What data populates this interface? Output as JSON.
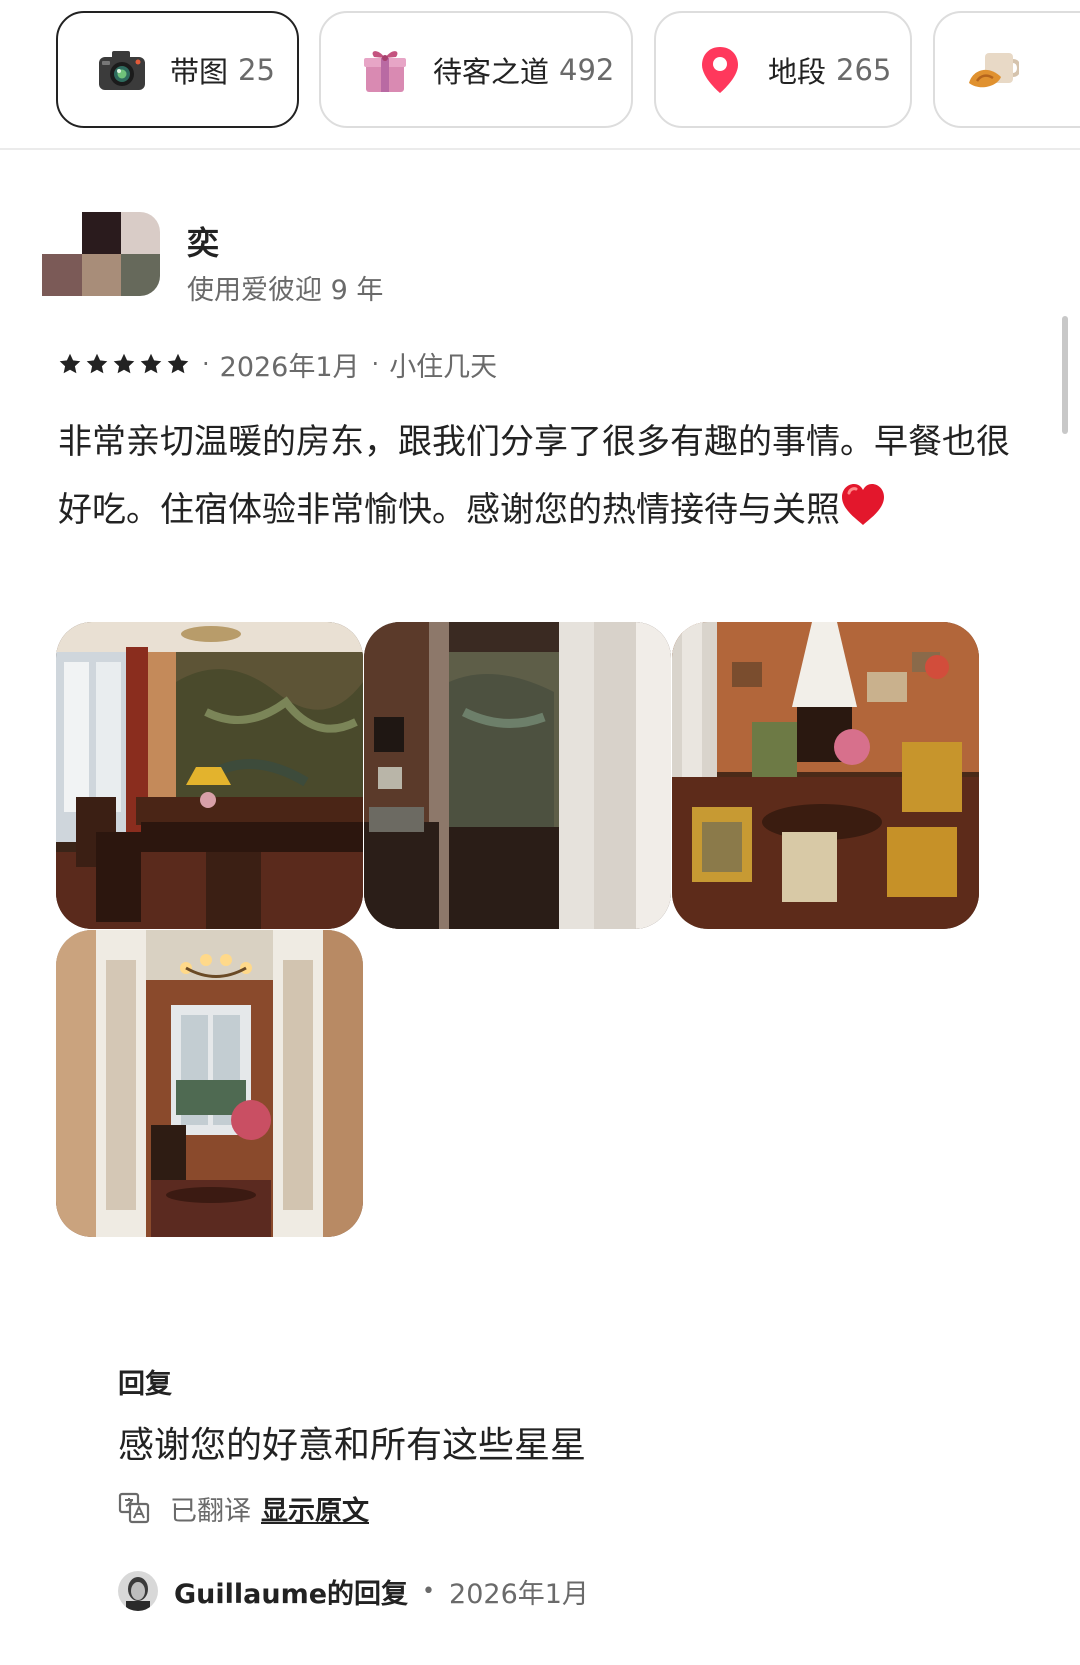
{
  "filters": [
    {
      "label": "带图",
      "count": "25",
      "icon": "camera-icon",
      "selected": true
    },
    {
      "label": "待客之道",
      "count": "492",
      "icon": "gift-icon",
      "selected": false
    },
    {
      "label": "地段",
      "count": "265",
      "icon": "location-pin-icon",
      "selected": false
    },
    {
      "label": "",
      "count": "",
      "icon": "breakfast-icon",
      "selected": false
    }
  ],
  "review": {
    "reviewer_name": "奕",
    "tenure": "使用爱彼迎 9 年",
    "rating": 5,
    "separator": "·",
    "date": "2026年1月",
    "stay_type": "小住几天",
    "text": "非常亲切温暖的房东，跟我们分享了很多有趣的事情。早餐也很好吃。住宿体验非常愉快。感谢您的热情接待与关照",
    "emoji": "red-heart-icon",
    "photo_count": 4
  },
  "reply": {
    "label": "回复",
    "text": "感谢您的好意和所有这些星星",
    "translated_label": "已翻译",
    "show_original": "显示原文",
    "host_name": "Guillaume的回复",
    "separator": "•",
    "date": "2026年1月"
  },
  "colors": {
    "text_primary": "#222222",
    "text_secondary": "#6a6a6a",
    "border": "#dddddd",
    "pin": "#ff385c"
  }
}
